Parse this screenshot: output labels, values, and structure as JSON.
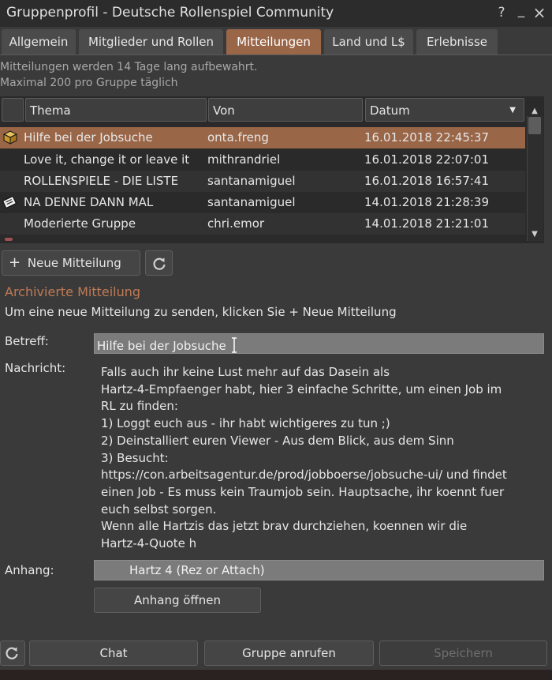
{
  "window": {
    "title": "Gruppenprofil - Deutsche Rollenspiel Community",
    "help_label": "?",
    "minimize_label": "_",
    "close_label": "×"
  },
  "tabs": [
    {
      "label": "Allgemein"
    },
    {
      "label": "Mitglieder und Rollen"
    },
    {
      "label": "Mitteilungen"
    },
    {
      "label": "Land und L$"
    },
    {
      "label": "Erlebnisse"
    }
  ],
  "active_tab": "Mitteilungen",
  "info": {
    "line1": "Mitteilungen werden 14 Tage lang aufbewahrt.",
    "line2": "Maximal 200 pro Gruppe täglich"
  },
  "table": {
    "columns": [
      "Thema",
      "Von",
      "Datum"
    ],
    "sort_indicator": "▼",
    "rows": [
      {
        "subject": "Hilfe bei der Jobsuche",
        "from": "onta.freng",
        "date": "16.01.2018 22:45:37",
        "icon": "package-icon"
      },
      {
        "subject": "Love it, change it or leave it",
        "from": "mithrandriel",
        "date": "16.01.2018 22:07:01",
        "icon": ""
      },
      {
        "subject": "ROLLENSPIELE - DIE LISTE",
        "from": "santanamiguel",
        "date": "16.01.2018 16:57:41",
        "icon": ""
      },
      {
        "subject": "NA DENNE DANN MAL",
        "from": "santanamiguel",
        "date": "14.01.2018 21:28:39",
        "icon": "notecard-icon"
      },
      {
        "subject": "Moderierte Gruppe",
        "from": "chri.emor",
        "date": "14.01.2018 21:21:01",
        "icon": ""
      }
    ]
  },
  "actions": {
    "new_notice_label": "Neue Mitteilung",
    "new_notice_plus": "+",
    "refresh_icon": "refresh-icon"
  },
  "notice": {
    "section_title": "Archivierte Mitteilung",
    "hint": "Um eine neue Mitteilung zu senden, klicken Sie + Neue Mitteilung",
    "subject_label": "Betreff:",
    "subject_value": "Hilfe bei der Jobsuche",
    "message_label": "Nachricht:",
    "message_body": "Falls auch ihr keine Lust mehr auf das Dasein als\nHartz-4-Empfaenger habt, hier 3 einfache Schritte, um einen Job im\nRL zu finden:\n1) Loggt euch aus - ihr habt wichtigeres zu tun ;)\n2) Deinstalliert euren Viewer - Aus dem Blick, aus dem Sinn\n3) Besucht:\nhttps://con.arbeitsagentur.de/prod/jobboerse/jobsuche-ui/ und findet\neinen Job - Es muss kein Traumjob sein. Hauptsache, ihr koennt fuer\neuch selbst sorgen.\nWenn alle Hartzis das jetzt brav durchziehen, koennen wir die\nHartz-4-Quote h",
    "attachment_label": "Anhang:",
    "attachment_value": "Hartz 4 (Rez or Attach)",
    "open_attachment_label": "Anhang öffnen"
  },
  "footer": {
    "chat_label": "Chat",
    "call_label": "Gruppe anrufen",
    "save_label": "Speichern"
  },
  "colors": {
    "accent": "#9a6648",
    "section_title": "#c07a55",
    "background": "#3a3a3a"
  }
}
